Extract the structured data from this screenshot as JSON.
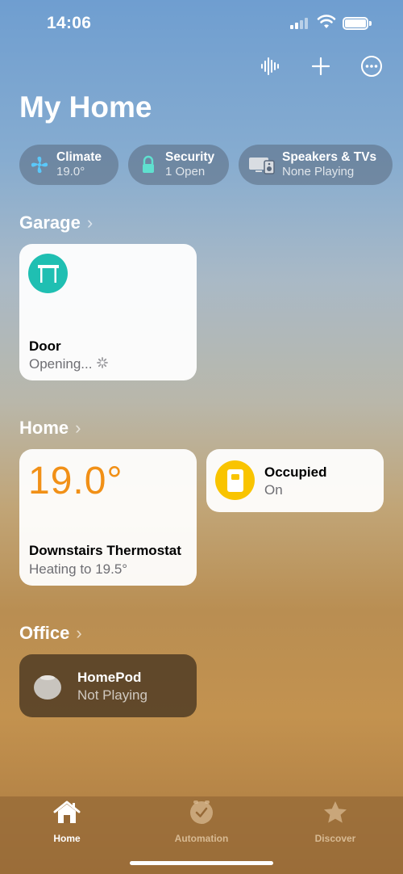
{
  "status_bar": {
    "time": "14:06"
  },
  "header": {
    "title": "My Home"
  },
  "chips": [
    {
      "title": "Climate",
      "subtitle": "19.0°"
    },
    {
      "title": "Security",
      "subtitle": "1 Open"
    },
    {
      "title": "Speakers & TVs",
      "subtitle": "None Playing"
    }
  ],
  "sections": {
    "garage": {
      "title": "Garage",
      "tiles": [
        {
          "name": "Door",
          "status": "Opening..."
        }
      ]
    },
    "home": {
      "title": "Home",
      "thermostat": {
        "temp": "19.0°",
        "name": "Downstairs Thermostat",
        "status": "Heating to 19.5°"
      },
      "occupied": {
        "name": "Occupied",
        "status": "On"
      }
    },
    "office": {
      "title": "Office",
      "homepod": {
        "name": "HomePod",
        "status": "Not Playing"
      }
    }
  },
  "tabs": [
    {
      "label": "Home",
      "icon": "house-icon",
      "active": true
    },
    {
      "label": "Automation",
      "icon": "clock-check-icon",
      "active": false
    },
    {
      "label": "Discover",
      "icon": "star-icon",
      "active": false
    }
  ],
  "colors": {
    "teal": "#1fbfb2",
    "orange": "#f19017",
    "yellow": "#f9c400"
  }
}
